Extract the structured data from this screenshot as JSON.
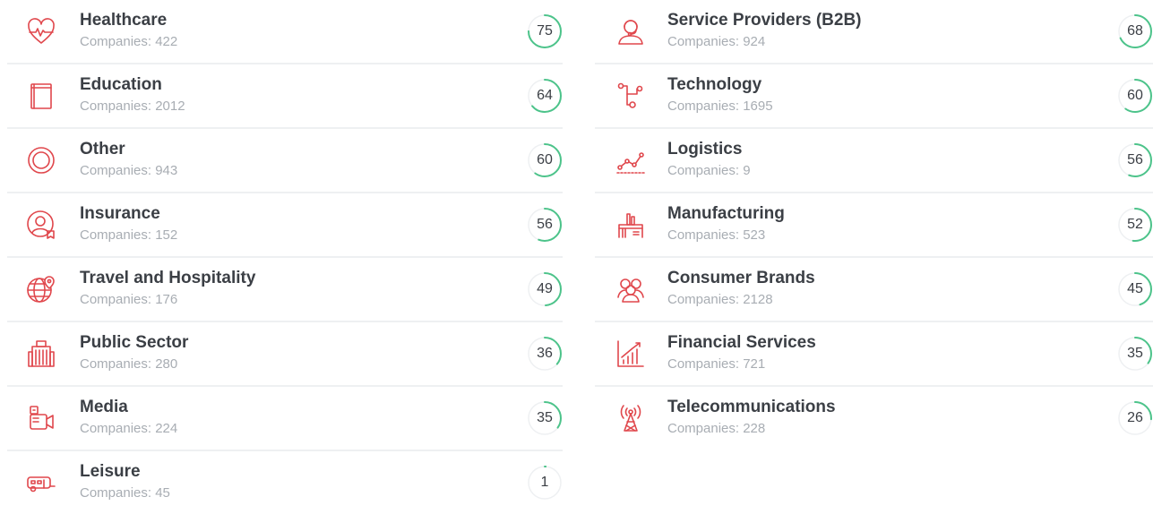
{
  "colors": {
    "icon": "#e0474c",
    "score_arc": "#4cc38a",
    "score_track": "#eef0f2",
    "title_text": "#3b3f45",
    "count_text": "#a8adb3"
  },
  "left_column": [
    {
      "name": "Healthcare",
      "count": "Companies: 422",
      "score": 75,
      "icon": "heart-pulse-icon"
    },
    {
      "name": "Education",
      "count": "Companies: 2012",
      "score": 64,
      "icon": "book-icon"
    },
    {
      "name": "Other",
      "count": "Companies: 943",
      "score": 60,
      "icon": "circle-icon"
    },
    {
      "name": "Insurance",
      "count": "Companies: 152",
      "score": 56,
      "icon": "user-badge-icon"
    },
    {
      "name": "Travel and Hospitality",
      "count": "Companies: 176",
      "score": 49,
      "icon": "globe-pin-icon"
    },
    {
      "name": "Public Sector",
      "count": "Companies: 280",
      "score": 36,
      "icon": "building-icon"
    },
    {
      "name": "Media",
      "count": "Companies: 224",
      "score": 35,
      "icon": "video-camera-icon"
    },
    {
      "name": "Leisure",
      "count": "Companies: 45",
      "score": 1,
      "icon": "caravan-icon"
    }
  ],
  "right_column": [
    {
      "name": "Service Providers (B2B)",
      "count": "Companies: 924",
      "score": 68,
      "icon": "support-agent-icon"
    },
    {
      "name": "Technology",
      "count": "Companies: 1695",
      "score": 60,
      "icon": "circuit-icon"
    },
    {
      "name": "Logistics",
      "count": "Companies: 9",
      "score": 56,
      "icon": "route-icon"
    },
    {
      "name": "Manufacturing",
      "count": "Companies: 523",
      "score": 52,
      "icon": "factory-icon"
    },
    {
      "name": "Consumer Brands",
      "count": "Companies: 2128",
      "score": 45,
      "icon": "people-group-icon"
    },
    {
      "name": "Financial Services",
      "count": "Companies: 721",
      "score": 35,
      "icon": "growth-chart-icon"
    },
    {
      "name": "Telecommunications",
      "count": "Companies: 228",
      "score": 26,
      "icon": "antenna-tower-icon"
    }
  ]
}
